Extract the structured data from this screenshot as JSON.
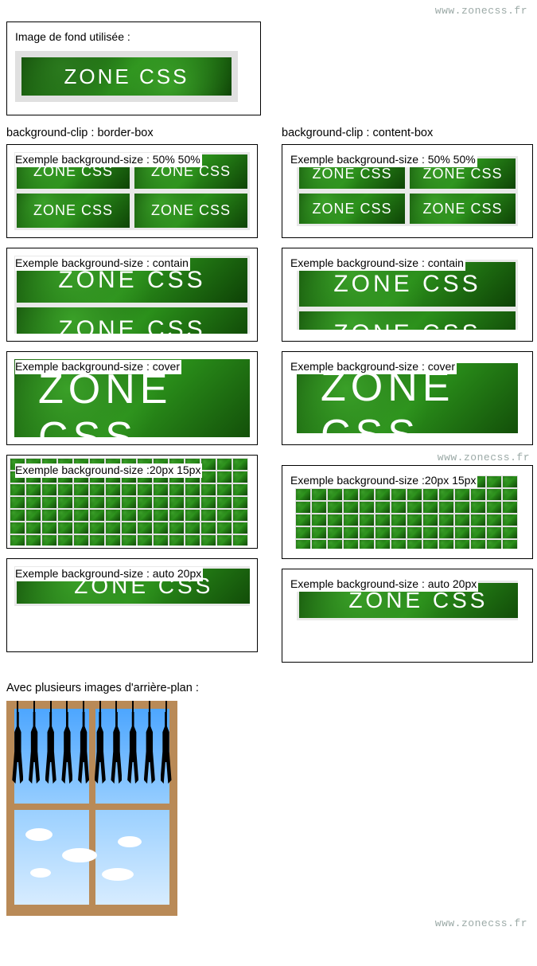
{
  "watermark": "www.zonecss.fr",
  "source": {
    "label": "Image de fond utilisée :",
    "badge_text": "ZONE CSS"
  },
  "columns": {
    "left_head": "background-clip : border-box",
    "right_head": "background-clip : content-box"
  },
  "examples": {
    "e1": "Exemple background-size : 50% 50%",
    "e2": "Exemple background-size : contain",
    "e3": "Exemple background-size : cover",
    "e4": "Exemple background-size :20px 15px",
    "e5": "Exemple background-size : auto 20px"
  },
  "tile_text": "ZONE CSS",
  "multi_bg_head": "Avec plusieurs images d'arrière-plan :"
}
